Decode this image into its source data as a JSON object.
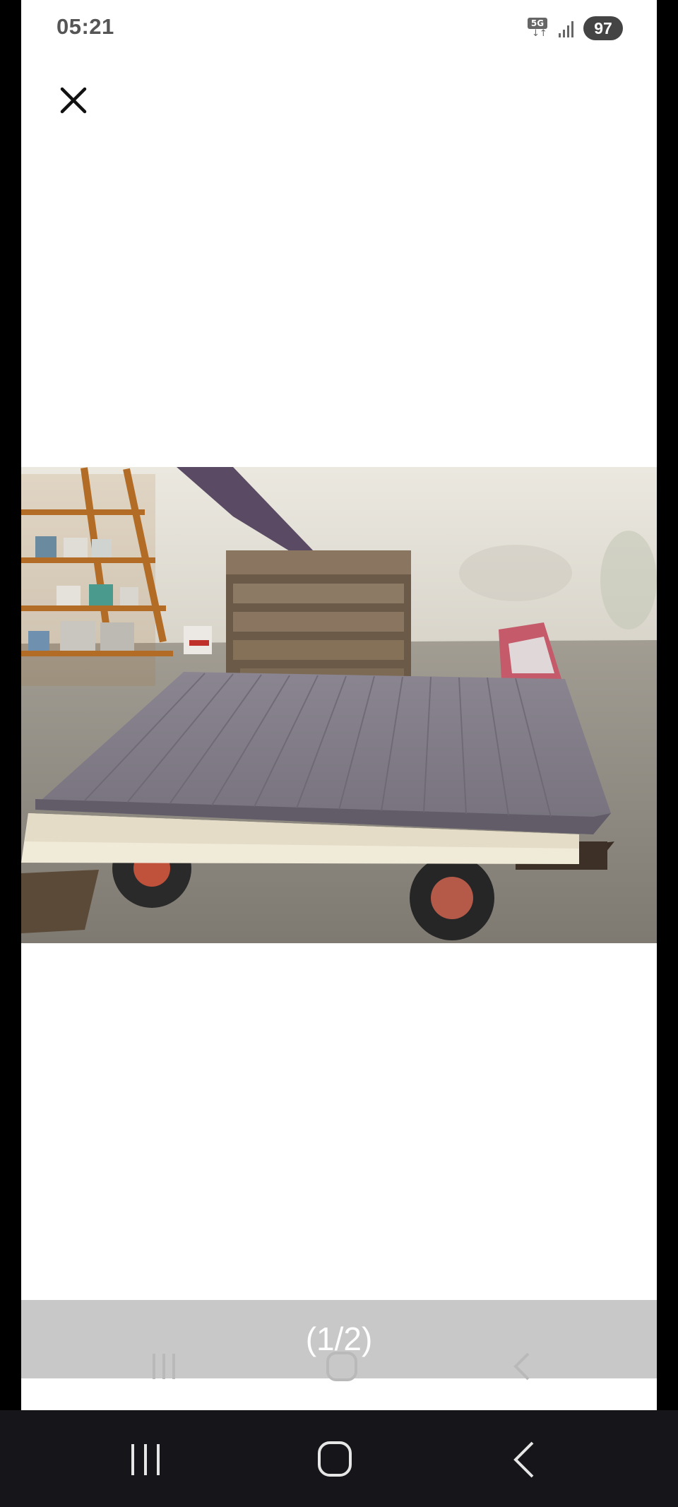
{
  "status_bar": {
    "time": "05:21",
    "network_label": "5G",
    "network_icon": "network-5g-icon",
    "signal_icon": "signal-strength-icon",
    "battery_level": "97"
  },
  "viewer": {
    "close_icon": "close-icon",
    "image_description_icon": "listing-photo",
    "pager_text": "(1/2)"
  },
  "navigation": {
    "recent_apps_icon": "recent-apps-icon",
    "home_icon": "home-icon",
    "back_icon": "back-icon"
  },
  "colors": {
    "background": "#ffffff",
    "pager_overlay": "#c8c8c8",
    "nav_bar": "#16161a"
  }
}
